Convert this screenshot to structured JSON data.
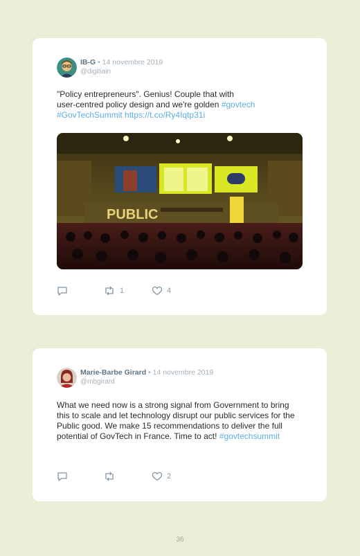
{
  "tweets": [
    {
      "author": "IB-G",
      "date": " • 14 novembre 2019",
      "handle": "@digitiain",
      "text_parts": {
        "t1": "\"Policy entrepreneurs\". Genius! Couple that with",
        "t2": "user-centred policy design and we're golden ",
        "h1": "#govtech",
        "h2": "#GovTechSummit",
        "url": "https://t.co/Ry4Iqtp31i"
      },
      "image_text": "PUBLIC",
      "retweets": "1",
      "likes": "4",
      "icons": {
        "reply": "reply-icon",
        "retweet": "retweet-icon",
        "like": "heart-icon"
      }
    },
    {
      "author": "Marie-Barbe Girard",
      "date": " • 14 novembre 2019",
      "handle": "@mbgirard",
      "text_parts": {
        "t1": "What we need now is a strong signal from Government to bring this to scale and let technology disrupt our public services for the Public good. We make 15 recommendations to deliver the full potential of GovTech in France. Time to act! ",
        "h1": "#govtechsummit"
      },
      "retweets": "",
      "likes": "2",
      "icons": {
        "reply": "reply-icon",
        "retweet": "retweet-icon",
        "like": "heart-icon"
      }
    }
  ],
  "colors": {
    "page_bg": "#eceed8",
    "link": "#5aaee3",
    "name": "#5b7488"
  },
  "page_number": "36"
}
